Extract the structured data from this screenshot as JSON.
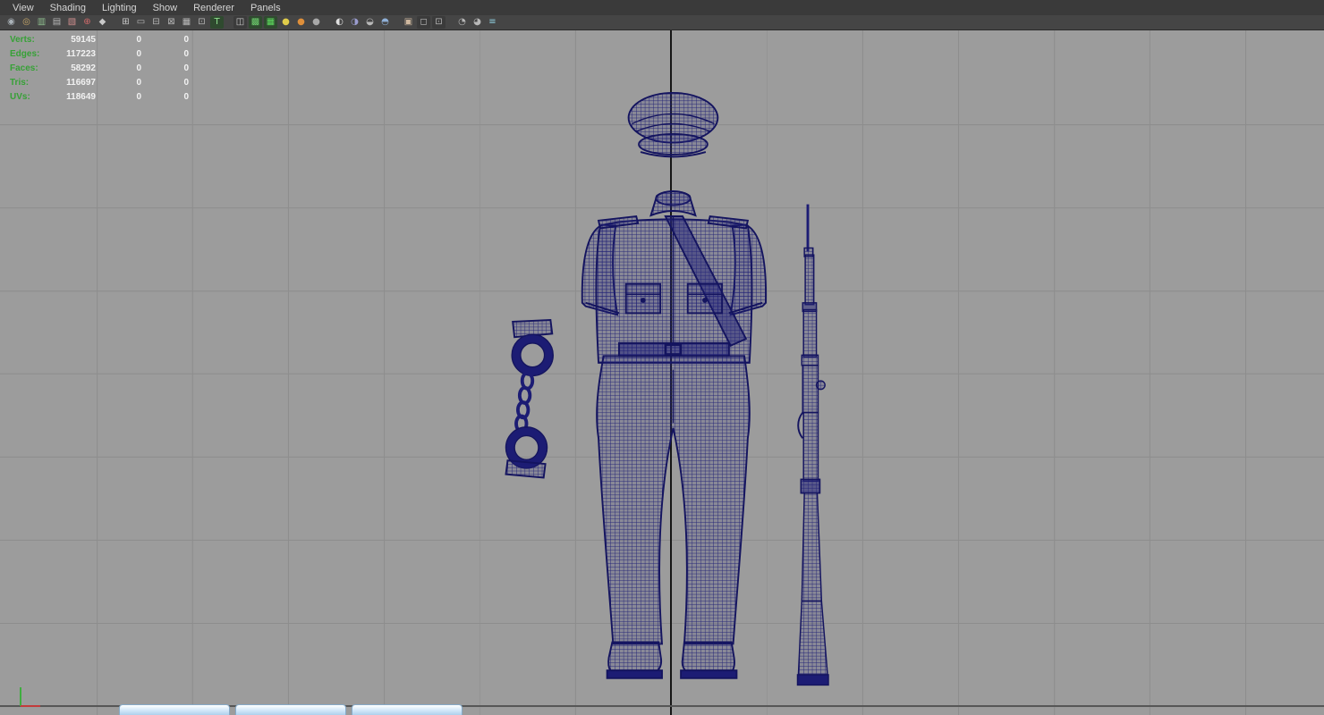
{
  "menubar": {
    "menus": [
      {
        "label": "View"
      },
      {
        "label": "Shading"
      },
      {
        "label": "Lighting"
      },
      {
        "label": "Show"
      },
      {
        "label": "Renderer"
      },
      {
        "label": "Panels"
      }
    ]
  },
  "toolbar": {
    "icons": [
      {
        "name": "select-camera-icon",
        "glyph": "◉",
        "fg": "#aab2b8"
      },
      {
        "name": "lock-camera-icon",
        "glyph": "◎",
        "fg": "#c9a96a"
      },
      {
        "name": "camera-attributes-icon",
        "glyph": "▥",
        "fg": "#8fbf8f"
      },
      {
        "name": "bookmarks-icon",
        "glyph": "▤",
        "fg": "#b8b8b8"
      },
      {
        "name": "image-plane-icon",
        "glyph": "▧",
        "fg": "#cf8f8f"
      },
      {
        "name": "pan-zoom-icon",
        "glyph": "⊕",
        "fg": "#cf6a6a"
      },
      {
        "name": "grease-pencil-icon",
        "glyph": "◆",
        "fg": "#c9c9c9"
      },
      {
        "name": "toolbar-separator",
        "glyph": "",
        "cls": "sep",
        "interactable": false
      },
      {
        "name": "grid-icon",
        "glyph": "⊞",
        "fg": "#c9c9c9"
      },
      {
        "name": "film-gate-icon",
        "glyph": "▭",
        "fg": "#b8b8b8"
      },
      {
        "name": "resolution-gate-icon",
        "glyph": "⊟",
        "fg": "#b8b8b8"
      },
      {
        "name": "gate-mask-icon",
        "glyph": "⊠",
        "fg": "#b8b8b8"
      },
      {
        "name": "field-chart-icon",
        "glyph": "▦",
        "fg": "#b8b8b8"
      },
      {
        "name": "safe-action-icon",
        "glyph": "⊡",
        "fg": "#b8b8b8"
      },
      {
        "name": "safe-title-icon",
        "glyph": "T",
        "fg": "#8fdf8f",
        "bg": "#2f4a2f"
      },
      {
        "name": "toolbar-separator",
        "glyph": "",
        "cls": "sep",
        "interactable": false
      },
      {
        "name": "wireframe-icon",
        "glyph": "◫",
        "fg": "#c9c9c9",
        "bg": "#3b3b3b"
      },
      {
        "name": "smooth-shade-icon",
        "glyph": "▩",
        "fg": "#6fcf6f",
        "bg": "#2f4a2f"
      },
      {
        "name": "textured-icon",
        "glyph": "▦",
        "fg": "#5fdf5f",
        "bg": "#2f4a2f"
      },
      {
        "name": "default-material-icon",
        "glyph": "●",
        "fg": "#e0cc4a"
      },
      {
        "name": "flat-shade-icon",
        "glyph": "●",
        "fg": "#df8f3a"
      },
      {
        "name": "bounding-box-icon",
        "glyph": "●",
        "fg": "#a8a8a8"
      },
      {
        "name": "toolbar-separator",
        "glyph": "",
        "cls": "sep",
        "interactable": false
      },
      {
        "name": "use-all-lights-icon",
        "glyph": "◐",
        "fg": "#e0e0e0"
      },
      {
        "name": "shadows-icon",
        "glyph": "◑",
        "fg": "#9a9ccf"
      },
      {
        "name": "ambient-occlusion-icon",
        "glyph": "◒",
        "fg": "#b8b8b8"
      },
      {
        "name": "motion-blur-icon",
        "glyph": "◓",
        "fg": "#8fb0d8"
      },
      {
        "name": "toolbar-separator",
        "glyph": "",
        "cls": "sep",
        "interactable": false
      },
      {
        "name": "isolate-select-icon",
        "glyph": "▣",
        "fg": "#cfb89f"
      },
      {
        "name": "xray-icon",
        "glyph": "◻",
        "fg": "#b8b8b8",
        "bg": "#3b3b3b"
      },
      {
        "name": "xray-joints-icon",
        "glyph": "⊡",
        "fg": "#b8b8b8",
        "bg": "#3b3b3b"
      },
      {
        "name": "toolbar-separator",
        "glyph": "",
        "cls": "sep",
        "interactable": false
      },
      {
        "name": "exposure-icon",
        "glyph": "◔",
        "fg": "#b8b8b8"
      },
      {
        "name": "gamma-icon",
        "glyph": "◕",
        "fg": "#b8b8b8"
      },
      {
        "name": "view-transform-icon",
        "glyph": "≡",
        "fg": "#8fcfdf"
      }
    ]
  },
  "hud": {
    "rows": [
      {
        "label": "Verts:",
        "v1": "59145",
        "v2": "0",
        "v3": "0"
      },
      {
        "label": "Edges:",
        "v1": "117223",
        "v2": "0",
        "v3": "0"
      },
      {
        "label": "Faces:",
        "v1": "58292",
        "v2": "0",
        "v3": "0"
      },
      {
        "label": "Tris:",
        "v1": "116697",
        "v2": "0",
        "v3": "0"
      },
      {
        "label": "UVs:",
        "v1": "118649",
        "v2": "0",
        "v3": "0"
      }
    ]
  },
  "viewport": {
    "background": "#9c9c9c",
    "grid_line_color": "#8d8d8d",
    "center_line_color": "#161616",
    "wireframe_color": "#1c1c74",
    "axis_x_color": "#c23b3b",
    "axis_y_color": "#3fae3f",
    "objects": [
      "police-cap",
      "police-shirt",
      "handcuffs",
      "police-trousers",
      "boots",
      "rifle"
    ]
  },
  "taskbar": {
    "buttons": [
      {
        "label": ""
      },
      {
        "label": ""
      },
      {
        "label": ""
      }
    ]
  }
}
